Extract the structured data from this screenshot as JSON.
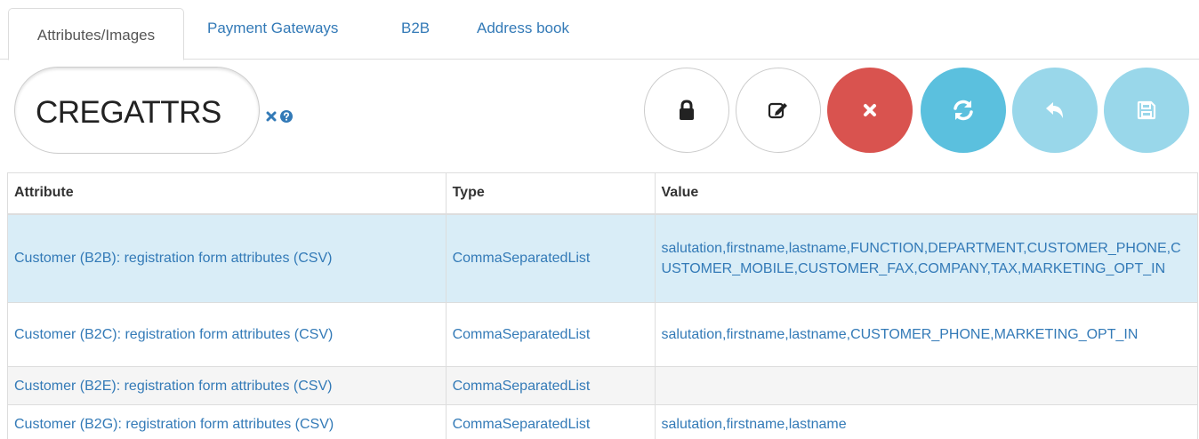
{
  "tabs": [
    {
      "label": "Attributes/Images",
      "active": true
    },
    {
      "label": "Payment Gateways",
      "active": false
    },
    {
      "label": "B2B",
      "active": false
    },
    {
      "label": "Address book",
      "active": false
    }
  ],
  "code": {
    "value": "CREGATTRS"
  },
  "toolbar": {
    "lock_icon": "lock-icon",
    "edit_icon": "edit-icon",
    "delete_icon": "close-icon",
    "refresh_icon": "refresh-icon",
    "undo_icon": "undo-icon",
    "save_icon": "save-icon"
  },
  "colors": {
    "link": "#337ab7",
    "danger": "#d9534f",
    "info": "#5bc0de",
    "info_disabled": "#99d7ea",
    "selected_row": "#d9edf7"
  },
  "table": {
    "headers": {
      "attribute": "Attribute",
      "type": "Type",
      "value": "Value"
    },
    "rows": [
      {
        "attribute": "Customer (B2B): registration form attributes (CSV)",
        "type": "CommaSeparatedList",
        "value": "salutation,firstname,lastname,FUNCTION,DEPARTMENT,CUSTOMER_PHONE,CUSTOMER_MOBILE,CUSTOMER_FAX,COMPANY,TAX,MARKETING_OPT_IN"
      },
      {
        "attribute": "Customer (B2C): registration form attributes (CSV)",
        "type": "CommaSeparatedList",
        "value": "salutation,firstname,lastname,CUSTOMER_PHONE,MARKETING_OPT_IN"
      },
      {
        "attribute": "Customer (B2E): registration form attributes (CSV)",
        "type": "CommaSeparatedList",
        "value": ""
      },
      {
        "attribute": "Customer (B2G): registration form attributes (CSV)",
        "type": "CommaSeparatedList",
        "value": "salutation,firstname,lastname"
      }
    ]
  }
}
